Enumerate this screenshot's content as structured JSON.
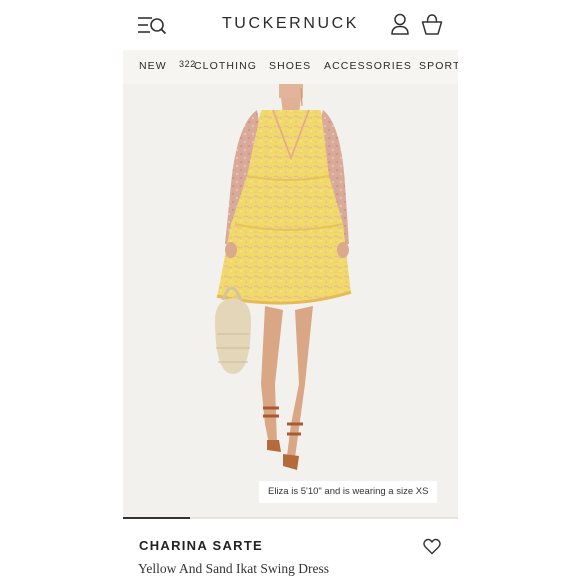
{
  "header": {
    "logo": "TUCKERNUCK",
    "icons": [
      "menu-search-icon",
      "account-icon",
      "shopping-bag-icon"
    ]
  },
  "nav": {
    "items": [
      {
        "label": "NEW",
        "badge": "322"
      },
      {
        "label": "CLOTHING"
      },
      {
        "label": "SHOES"
      },
      {
        "label": "ACCESSORIES"
      },
      {
        "label": "SPORT"
      }
    ]
  },
  "product": {
    "image_caption": "Eliza is 5'10\" and is wearing a size XS",
    "gallery_progress": 0.2,
    "brand": "CHARINA SARTE",
    "name": "Yellow And Sand Ikat Swing Dress",
    "wishlist_icon": "heart-outline-icon"
  },
  "colors": {
    "nav_bg": "#f7f5f2",
    "hero_bg": "#f3f1ee",
    "dress_yellow": "#f2dc6a",
    "sleeve_pink": "#d9a99a"
  }
}
